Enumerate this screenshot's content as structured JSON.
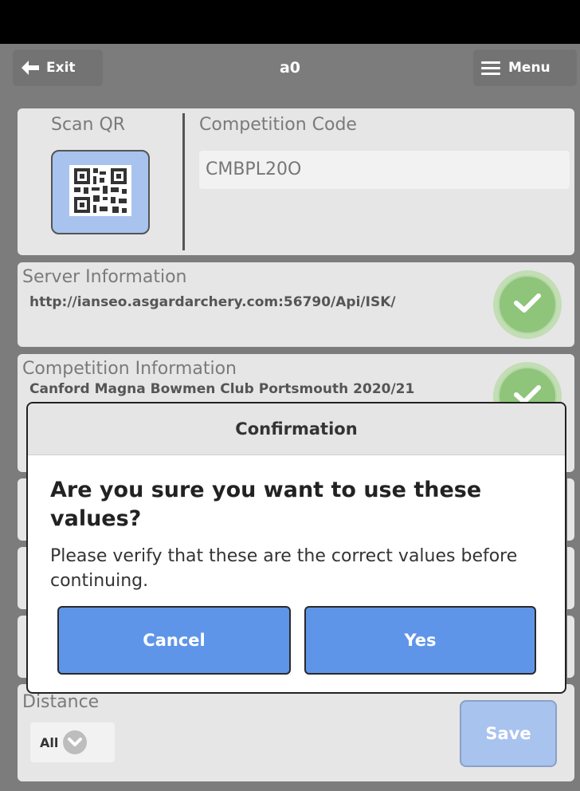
{
  "header": {
    "exit_label": "Exit",
    "title": "a0",
    "menu_label": "Menu"
  },
  "scan": {
    "label": "Scan QR",
    "icon": "qr-code-icon"
  },
  "competition_code": {
    "label": "Competition Code",
    "value": "CMBPL20O"
  },
  "server": {
    "label": "Server Information",
    "url": "http://ianseo.asgardarchery.com:56790/Api/ISK/",
    "status_icon": "check-icon"
  },
  "competition": {
    "label": "Competition Information",
    "name": "Canford Magna Bowmen Club Portsmouth 2020/21"
  },
  "distance": {
    "label": "Distance",
    "selected": "All"
  },
  "save_label": "Save",
  "dialog": {
    "header": "Confirmation",
    "title": "Are you sure you want to use these values?",
    "message": "Please verify that these are the correct values before continuing.",
    "cancel_label": "Cancel",
    "yes_label": "Yes"
  },
  "colors": {
    "primary_button": "#5f95e8",
    "disabled_button": "#a9c3ef",
    "success": "#8ec57a"
  }
}
